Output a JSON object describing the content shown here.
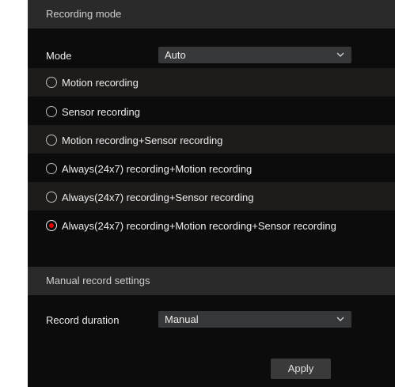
{
  "recording_mode": {
    "header": "Recording mode",
    "mode_label": "Mode",
    "mode_value": "Auto",
    "options": [
      {
        "label": "Motion recording",
        "selected": false
      },
      {
        "label": "Sensor recording",
        "selected": false
      },
      {
        "label": "Motion recording+Sensor recording",
        "selected": false
      },
      {
        "label": "Always(24x7) recording+Motion recording",
        "selected": false
      },
      {
        "label": "Always(24x7) recording+Sensor recording",
        "selected": false
      },
      {
        "label": "Always(24x7) recording+Motion recording+Sensor recording",
        "selected": true
      }
    ]
  },
  "manual_record": {
    "header": "Manual record settings",
    "duration_label": "Record duration",
    "duration_value": "Manual"
  },
  "apply_label": "Apply",
  "colors": {
    "background": "#0c0c0c",
    "header_bg": "#2a2a2a",
    "row_shaded": "#1e1c1b",
    "select_bg": "#363738",
    "radio_selected": "#e00000"
  },
  "icons": {
    "dropdown": "chevron-down-icon"
  }
}
